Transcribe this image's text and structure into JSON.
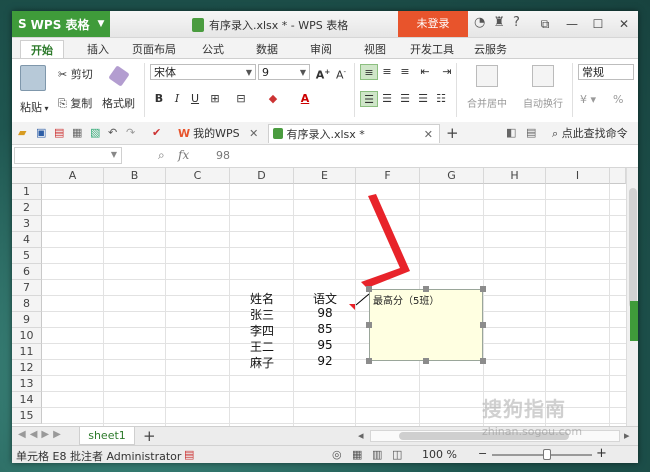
{
  "app": {
    "name": "WPS 表格",
    "logo": "S",
    "doc_title": "有序录入.xlsx * - WPS 表格",
    "login": "未登录"
  },
  "tabs": [
    "开始",
    "插入",
    "页面布局",
    "公式",
    "数据",
    "审阅",
    "视图",
    "开发工具",
    "云服务"
  ],
  "ribbon": {
    "paste": "粘贴",
    "cut": "剪切",
    "copy": "复制",
    "format_painter": "格式刷",
    "font_name": "宋体",
    "font_size": "9",
    "merge": "合并居中",
    "wrap": "自动换行",
    "number_format": "常规",
    "percent": "%"
  },
  "doctabs": {
    "mywps": "我的WPS",
    "current": "有序录入.xlsx *",
    "find": "点此查找命令"
  },
  "formula": {
    "fx": "fx",
    "value": "98"
  },
  "columns": [
    "A",
    "B",
    "C",
    "D",
    "E",
    "F",
    "G",
    "H",
    "I"
  ],
  "rows": [
    "1",
    "2",
    "3",
    "4",
    "5",
    "6",
    "7",
    "8",
    "9",
    "10",
    "11",
    "12",
    "13",
    "14",
    "15"
  ],
  "table": {
    "header_name": "姓名",
    "header_score": "语文",
    "names": [
      "张三",
      "李四",
      "王二",
      "麻子"
    ],
    "scores": [
      "98",
      "85",
      "95",
      "92"
    ]
  },
  "comment": "最高分（5班）",
  "sheet": "sheet1",
  "status": {
    "left": "单元格 E8 批注者 Administrator",
    "zoom": "100 %"
  },
  "colors": {
    "brand_green": "#3f9b3a",
    "login_red": "#e8542c",
    "annotation_red": "#e8232a",
    "comment_bg": "#ffffe1"
  },
  "watermark": {
    "text": "搜狗指南",
    "url": "zhinan.sogou.com"
  }
}
